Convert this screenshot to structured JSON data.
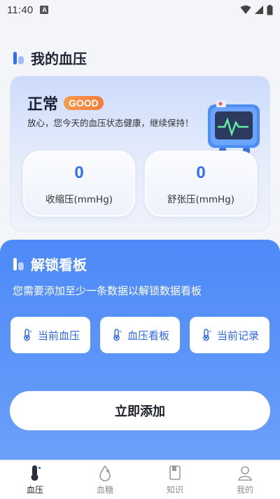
{
  "status_bar": {
    "time": "11:40",
    "notif_letter": "A"
  },
  "header": {
    "title": "我的血压"
  },
  "bp_card": {
    "status": "正常",
    "badge": "GOOD",
    "description": "放心，您今天的血压状态健康，继续保持！",
    "systolic": {
      "value": "0",
      "label": "收缩压(mmHg)"
    },
    "diastolic": {
      "value": "0",
      "label": "舒张压(mmHg)"
    }
  },
  "dashboard": {
    "title": "解锁看板",
    "description": "您需要添加至少一条数据以解锁数据看板",
    "buttons": [
      {
        "label": "当前血压",
        "icon": "thermometer-icon"
      },
      {
        "label": "血压看板",
        "icon": "thermometer-icon"
      },
      {
        "label": "当前记录",
        "icon": "thermometer-icon"
      }
    ],
    "add_label": "立即添加"
  },
  "tabs": [
    {
      "label": "血压",
      "icon": "bp-tab-icon",
      "active": true
    },
    {
      "label": "血糖",
      "icon": "drop-tab-icon",
      "active": false
    },
    {
      "label": "知识",
      "icon": "book-tab-icon",
      "active": false
    },
    {
      "label": "我的",
      "icon": "user-tab-icon",
      "active": false
    }
  ],
  "colors": {
    "accent": "#2f6ff2",
    "panel": "#5a93f9",
    "badge": "#f5893f"
  }
}
